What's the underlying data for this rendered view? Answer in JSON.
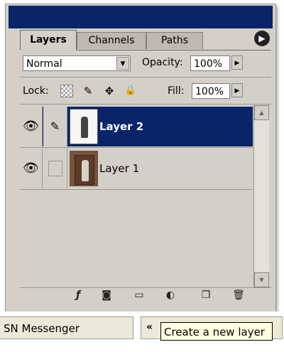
{
  "panel": {
    "tabs": [
      {
        "label": "Layers",
        "active": true
      },
      {
        "label": "Channels",
        "active": false
      },
      {
        "label": "Paths",
        "active": false
      }
    ],
    "menu_icon": "flyout-menu-arrow-icon"
  },
  "blend_mode": {
    "value": "Normal"
  },
  "opacity": {
    "label": "Opacity:",
    "value": "100%"
  },
  "lock": {
    "label": "Lock:",
    "icons": [
      "transparency-lock-icon",
      "brush-lock-icon",
      "move-lock-icon",
      "padlock-icon"
    ]
  },
  "fill": {
    "label": "Fill:",
    "value": "100%"
  },
  "layers": [
    {
      "name": "Layer 2",
      "selected": true,
      "visible": true,
      "linked_icon": "brush-icon"
    },
    {
      "name": "Layer 1",
      "selected": false,
      "visible": true
    }
  ],
  "bottom_icons": [
    "layer-style-icon",
    "layer-mask-icon",
    "new-group-folder-icon",
    "adjustment-layer-icon",
    "new-layer-icon",
    "trash-icon"
  ],
  "taskbar": {
    "button_label": "SN Messenger",
    "tray_chevron": "«",
    "tooltip": "Create a new layer"
  },
  "colors": {
    "selection": "#0a246a",
    "panel_bg": "#d4d0c8",
    "tooltip_bg": "#ffffe1"
  }
}
